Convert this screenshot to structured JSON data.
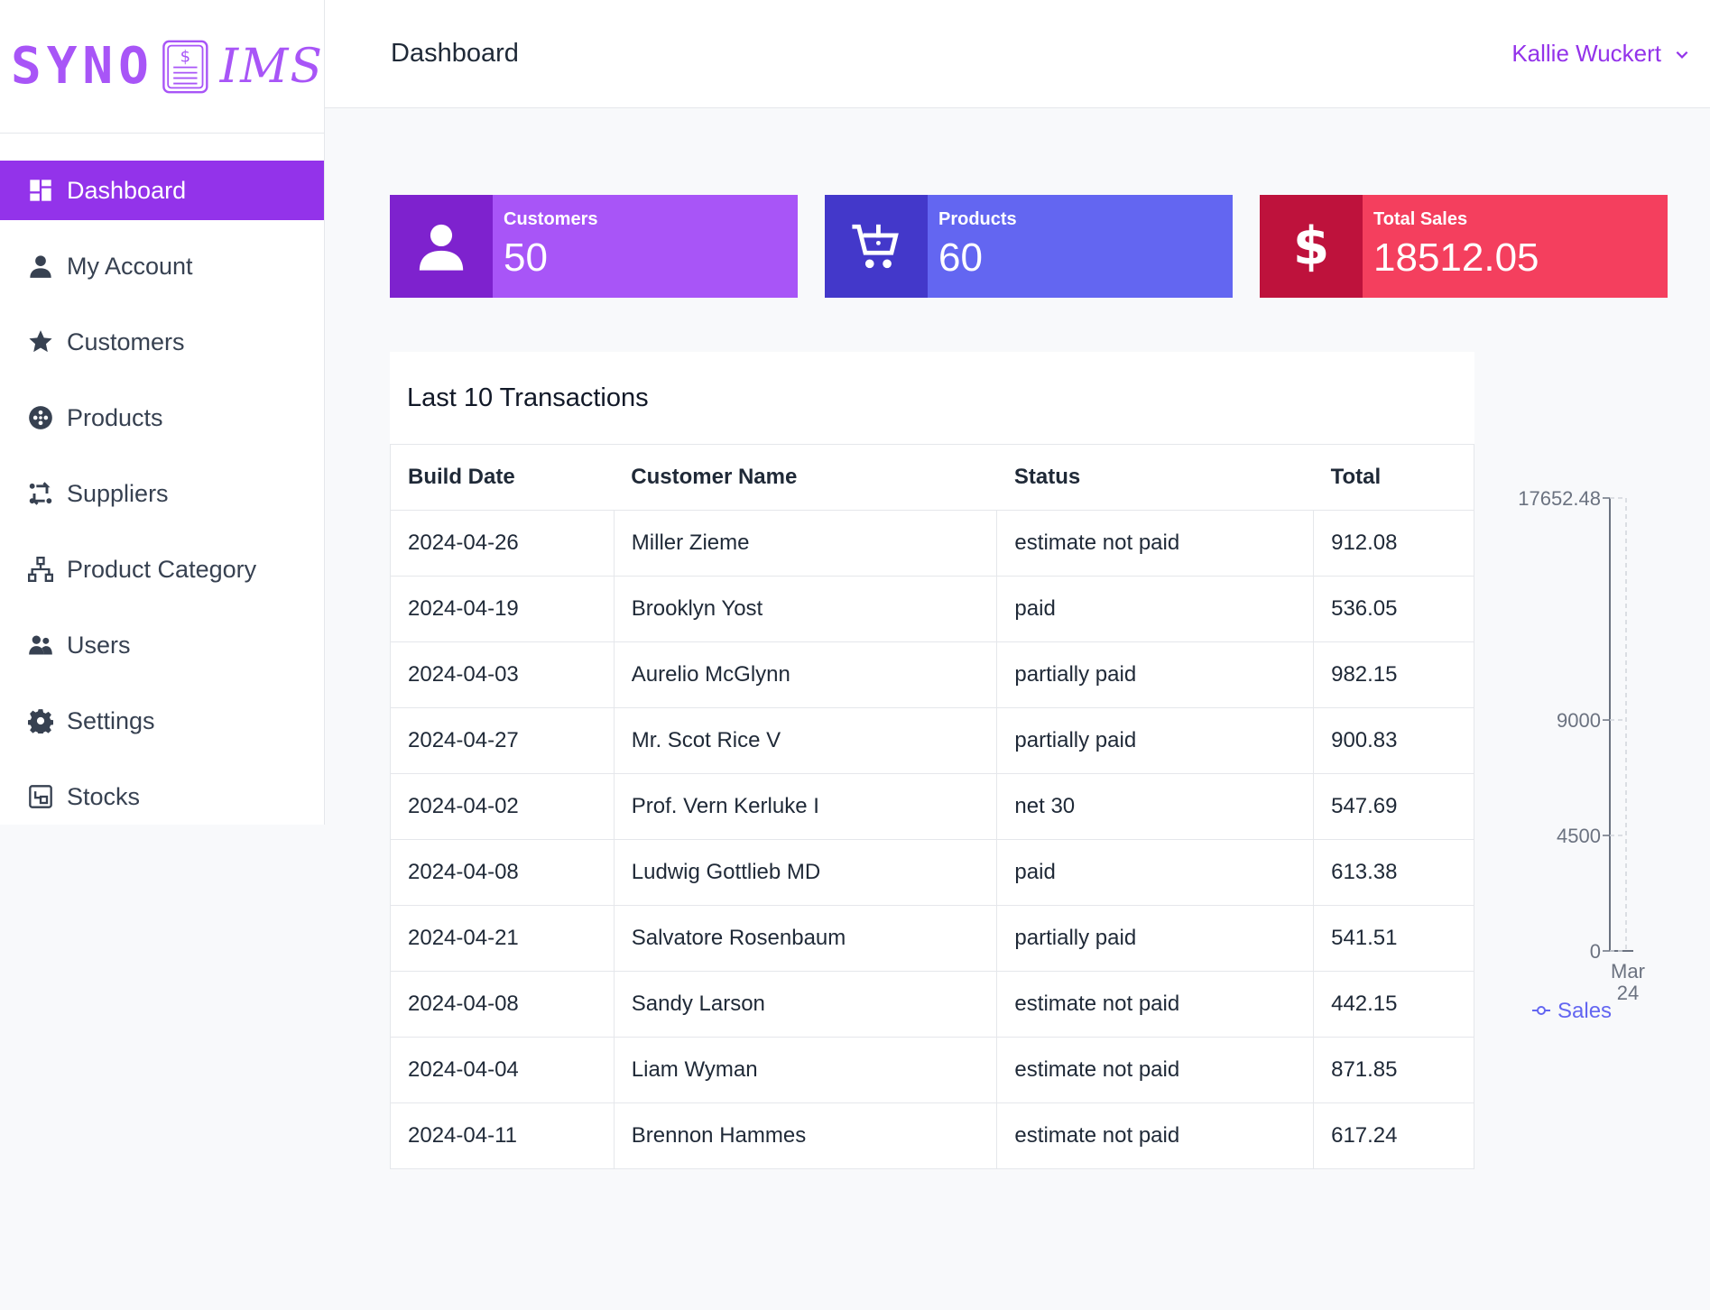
{
  "app": {
    "logo_left": "SYNO",
    "logo_right": "IMS"
  },
  "header": {
    "title": "Dashboard",
    "user_name": "Kallie Wuckert"
  },
  "sidebar": {
    "items": [
      {
        "label": "Dashboard",
        "icon": "dashboard-icon"
      },
      {
        "label": "My Account",
        "icon": "user-icon"
      },
      {
        "label": "Customers",
        "icon": "star-icon"
      },
      {
        "label": "Products",
        "icon": "products-icon"
      },
      {
        "label": "Suppliers",
        "icon": "suppliers-icon"
      },
      {
        "label": "Product Category",
        "icon": "sitemap-icon"
      },
      {
        "label": "Users",
        "icon": "users-icon"
      },
      {
        "label": "Settings",
        "icon": "gear-icon"
      },
      {
        "label": "Stocks",
        "icon": "stocks-icon"
      }
    ]
  },
  "cards": {
    "customers": {
      "label": "Customers",
      "value": "50",
      "icon": "user-icon"
    },
    "products": {
      "label": "Products",
      "value": "60",
      "icon": "cart-icon"
    },
    "sales": {
      "label": "Total Sales",
      "value": "18512.05",
      "icon": "dollar-icon"
    }
  },
  "transactions": {
    "title": "Last 10 Transactions",
    "columns": [
      "Build Date",
      "Customer Name",
      "Status",
      "Total"
    ],
    "rows": [
      [
        "2024-04-26",
        "Miller Zieme",
        "estimate not paid",
        "912.08"
      ],
      [
        "2024-04-19",
        "Brooklyn Yost",
        "paid",
        "536.05"
      ],
      [
        "2024-04-03",
        "Aurelio McGlynn",
        "partially paid",
        "982.15"
      ],
      [
        "2024-04-27",
        "Mr. Scot Rice V",
        "partially paid",
        "900.83"
      ],
      [
        "2024-04-02",
        "Prof. Vern Kerluke I",
        "net 30",
        "547.69"
      ],
      [
        "2024-04-08",
        "Ludwig Gottlieb MD",
        "paid",
        "613.38"
      ],
      [
        "2024-04-21",
        "Salvatore Rosenbaum",
        "partially paid",
        "541.51"
      ],
      [
        "2024-04-08",
        "Sandy Larson",
        "estimate not paid",
        "442.15"
      ],
      [
        "2024-04-04",
        "Liam Wyman",
        "estimate not paid",
        "871.85"
      ],
      [
        "2024-04-11",
        "Brennon Hammes",
        "estimate not paid",
        "617.24"
      ]
    ]
  },
  "colors": {
    "accent": "#9333ea",
    "customers_icon_bg": "#7e22ce",
    "customers_bg": "#a855f7",
    "products_icon_bg": "#4338ca",
    "products_bg": "#6366f1",
    "sales_icon_bg": "#be123c",
    "sales_bg": "#f43f5e"
  },
  "chart_data": {
    "type": "line",
    "x": [
      "Mar 24"
    ],
    "series": [
      {
        "name": "Sales",
        "values": [
          0
        ]
      }
    ],
    "yticks": [
      "17652.48",
      "9000",
      "4500",
      "0"
    ],
    "ylim": [
      0,
      17652.48
    ],
    "legend": "bottom"
  }
}
